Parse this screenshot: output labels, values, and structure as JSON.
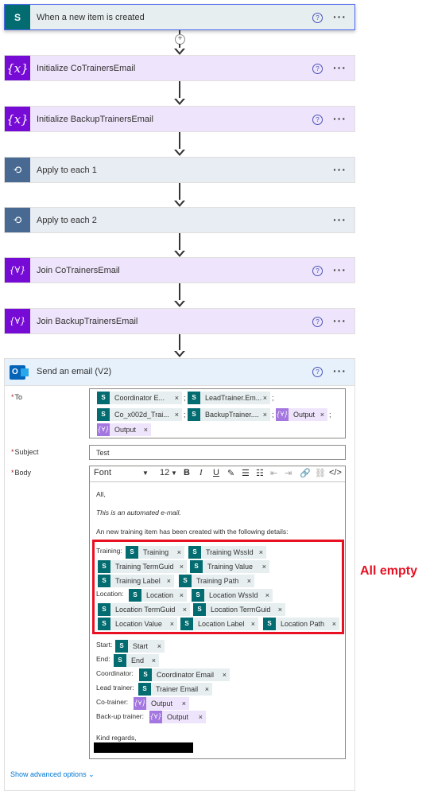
{
  "steps": [
    {
      "title": "When a new item is created",
      "icon": "sharepoint-icon"
    },
    {
      "title": "Initialize CoTrainersEmail",
      "icon": "variable-icon"
    },
    {
      "title": "Initialize BackupTrainersEmail",
      "icon": "variable-icon"
    },
    {
      "title": "Apply to each 1",
      "icon": "loop-icon"
    },
    {
      "title": "Apply to each 2",
      "icon": "loop-icon"
    },
    {
      "title": "Join CoTrainersEmail",
      "icon": "join-icon"
    },
    {
      "title": "Join BackupTrainersEmail",
      "icon": "join-icon"
    }
  ],
  "common": {
    "help": "?",
    "more": "···",
    "plus": "+",
    "remove": "×",
    "sp_letter": "S",
    "sep": ";"
  },
  "email": {
    "title": "Send an email (V2)",
    "to_label": "To",
    "subject_label": "Subject",
    "body_label": "Body",
    "required_mark": "*",
    "to_tokens": [
      "Coordinator E...",
      "LeadTrainer.Em...",
      "Co_x002d_Trai...",
      "BackupTrainer....",
      "Output",
      "Output"
    ],
    "subject_value": "Test",
    "toolbar": {
      "font": "Font",
      "size": "12",
      "bold": "B",
      "italic": "I",
      "underline": "U"
    },
    "body": {
      "greeting": "All,",
      "automated": "This is an automated e-mail.",
      "intro": "An new training item has been created with the following details:",
      "training_label": "Training:",
      "location_label": "Location:",
      "training_tokens": [
        "Training",
        "Training WssId",
        "Training TermGuid",
        "Training Value",
        "Training Label",
        "Training Path"
      ],
      "location_tokens": [
        "Location",
        "Location WssId",
        "Location TermGuid",
        "Location TermGuid",
        "Location Value",
        "Location Label",
        "Location Path"
      ],
      "start_label": "Start:",
      "start_token": "Start",
      "end_label": "End:",
      "end_token": "End",
      "coordinator_label": "Coordinator:",
      "coordinator_token": "Coordinator Email",
      "lead_label": "Lead trainer:",
      "lead_token": "Trainer Email",
      "cotrainer_label": "Co-trainer:",
      "cotrainer_token": "Output",
      "backup_label": "Back-up trainer:",
      "backup_token": "Output",
      "regards": "Kind regards,"
    },
    "advanced": "Show advanced options"
  },
  "annotation": "All empty",
  "colors": {
    "variable": "#770bd6",
    "loop": "#486991",
    "sharepoint": "#036c70",
    "highlight": "#e81123"
  }
}
